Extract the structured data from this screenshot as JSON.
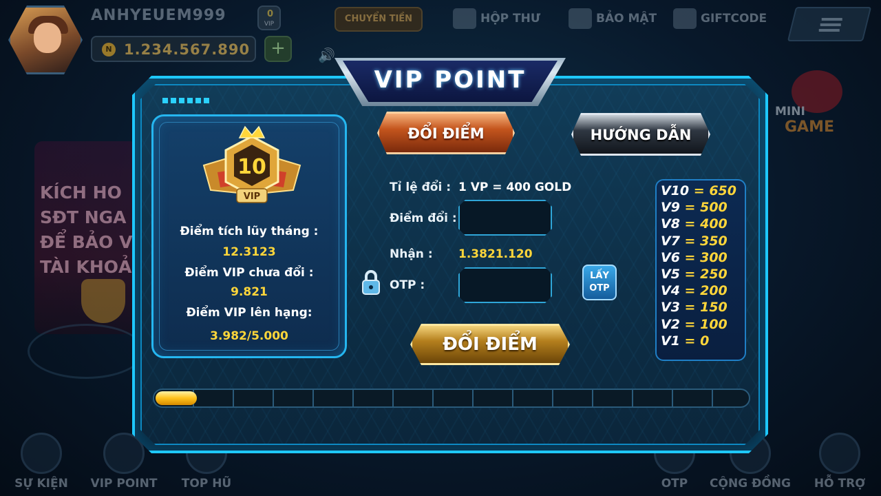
{
  "header": {
    "username": "ANHYEUEM999",
    "vip_small": "VIP",
    "vip_small_level": "0",
    "balance": "1.234.567.890",
    "coin_letter": "N",
    "transfer_label": "CHUYỂN TIỀN",
    "nav": [
      {
        "label": "HỘP THƯ",
        "icon": "mail-icon"
      },
      {
        "label": "BẢO MẬT",
        "icon": "shield-icon"
      },
      {
        "label": "GIFTCODE",
        "icon": "gift-icon"
      }
    ]
  },
  "background": {
    "promo_text": [
      "KÍCH HO",
      "SĐT NGA",
      "ĐỂ BẢO V",
      "TÀI KHOẢ"
    ],
    "minigame_line1": "MINI",
    "minigame_line2": "GAME"
  },
  "bottom_nav": [
    {
      "label": "SỰ KIỆN",
      "icon": "calendar-icon"
    },
    {
      "label": "VIP POINT",
      "icon": "crown-icon"
    },
    {
      "label": "TOP HŨ",
      "icon": "trophy-icon"
    },
    {
      "label": "OTP",
      "icon": "phone-lock-icon"
    },
    {
      "label": "CỘNG ĐỒNG",
      "icon": "community-icon"
    },
    {
      "label": "HỖ TRỢ",
      "icon": "support-icon"
    }
  ],
  "modal": {
    "title": "VIP POINT",
    "tabs": {
      "exchange": "ĐỔI ĐIỂM",
      "guide": "HƯỚNG DẪN"
    },
    "vip_level": "10",
    "vip_badge_label": "VIP",
    "info": {
      "monthly_label": "Điểm tích lũy tháng :",
      "monthly_value": "12.3123",
      "unexchanged_label": "Điểm VIP chưa đổi :",
      "unexchanged_value": "9.821",
      "levelup_label": "Điểm VIP lên hạng:",
      "levelup_value": "3.982/5.000"
    },
    "form": {
      "rate_label": "Tỉ lệ đổi :",
      "rate_value": "1 VP = 400 GOLD",
      "points_label": "Điểm đổi :",
      "points_value": "",
      "receive_label": "Nhận :",
      "receive_value": "1.3821.120",
      "otp_label": "OTP :",
      "otp_value": "",
      "get_otp_line1": "LẤY",
      "get_otp_line2": "OTP",
      "submit_label": "ĐỔI ĐIỂM"
    },
    "rates": [
      {
        "level": "V10",
        "points": "650"
      },
      {
        "level": "V9",
        "points": "500"
      },
      {
        "level": "V8",
        "points": "400"
      },
      {
        "level": "V7",
        "points": "350"
      },
      {
        "level": "V6",
        "points": "300"
      },
      {
        "level": "V5",
        "points": "250"
      },
      {
        "level": "V4",
        "points": "200"
      },
      {
        "level": "V3",
        "points": "150"
      },
      {
        "level": "V2",
        "points": "100"
      },
      {
        "level": "V1",
        "points": "0"
      }
    ],
    "progress_fraction": 0.07
  },
  "colors": {
    "accent": "#1ec8ff",
    "gold": "#ffd63a",
    "orange_tab": "#c4551d"
  }
}
